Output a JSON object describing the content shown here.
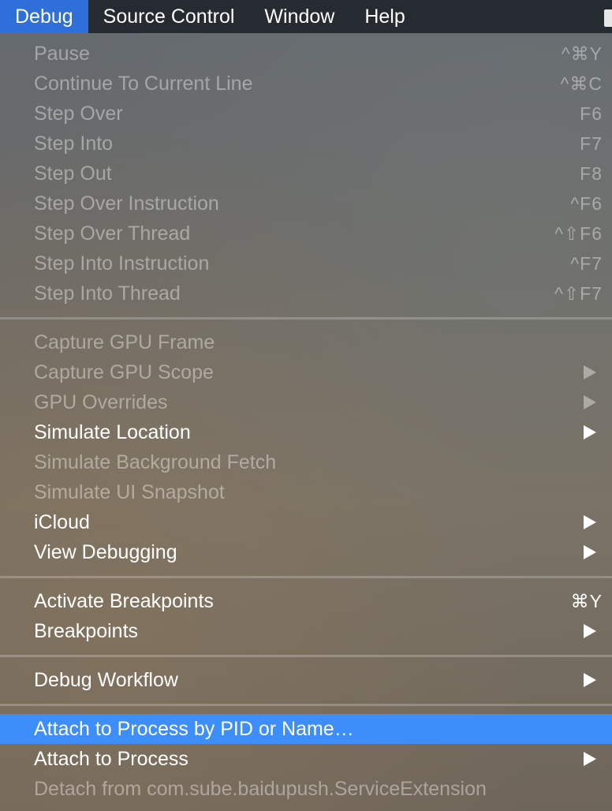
{
  "menubar": {
    "items": [
      {
        "label": "Debug",
        "active": true
      },
      {
        "label": "Source Control"
      },
      {
        "label": "Window"
      },
      {
        "label": "Help"
      }
    ]
  },
  "menu": {
    "groups": [
      [
        {
          "label": "Pause",
          "shortcut": "^⌘Y",
          "enabled": false
        },
        {
          "label": "Continue To Current Line",
          "shortcut": "^⌘C",
          "enabled": false
        },
        {
          "label": "Step Over",
          "shortcut": "F6",
          "enabled": false
        },
        {
          "label": "Step Into",
          "shortcut": "F7",
          "enabled": false
        },
        {
          "label": "Step Out",
          "shortcut": "F8",
          "enabled": false
        },
        {
          "label": "Step Over Instruction",
          "shortcut": "^F6",
          "enabled": false
        },
        {
          "label": "Step Over Thread",
          "shortcut": "^⇧F6",
          "enabled": false
        },
        {
          "label": "Step Into Instruction",
          "shortcut": "^F7",
          "enabled": false
        },
        {
          "label": "Step Into Thread",
          "shortcut": "^⇧F7",
          "enabled": false
        }
      ],
      [
        {
          "label": "Capture GPU Frame",
          "enabled": false
        },
        {
          "label": "Capture GPU Scope",
          "submenu": true,
          "enabled": false
        },
        {
          "label": "GPU Overrides",
          "submenu": true,
          "enabled": false
        },
        {
          "label": "Simulate Location",
          "submenu": true,
          "enabled": true
        },
        {
          "label": "Simulate Background Fetch",
          "enabled": false
        },
        {
          "label": "Simulate UI Snapshot",
          "enabled": false
        },
        {
          "label": "iCloud",
          "submenu": true,
          "enabled": true
        },
        {
          "label": "View Debugging",
          "submenu": true,
          "enabled": true
        }
      ],
      [
        {
          "label": "Activate Breakpoints",
          "shortcut": "⌘Y",
          "enabled": true
        },
        {
          "label": "Breakpoints",
          "submenu": true,
          "enabled": true
        }
      ],
      [
        {
          "label": "Debug Workflow",
          "submenu": true,
          "enabled": true
        }
      ],
      [
        {
          "label": "Attach to Process by PID or Name…",
          "enabled": true,
          "highlighted": true
        },
        {
          "label": "Attach to Process",
          "submenu": true,
          "enabled": true
        },
        {
          "label": "Detach from com.sube.baidupush.ServiceExtension",
          "enabled": false
        }
      ]
    ]
  }
}
